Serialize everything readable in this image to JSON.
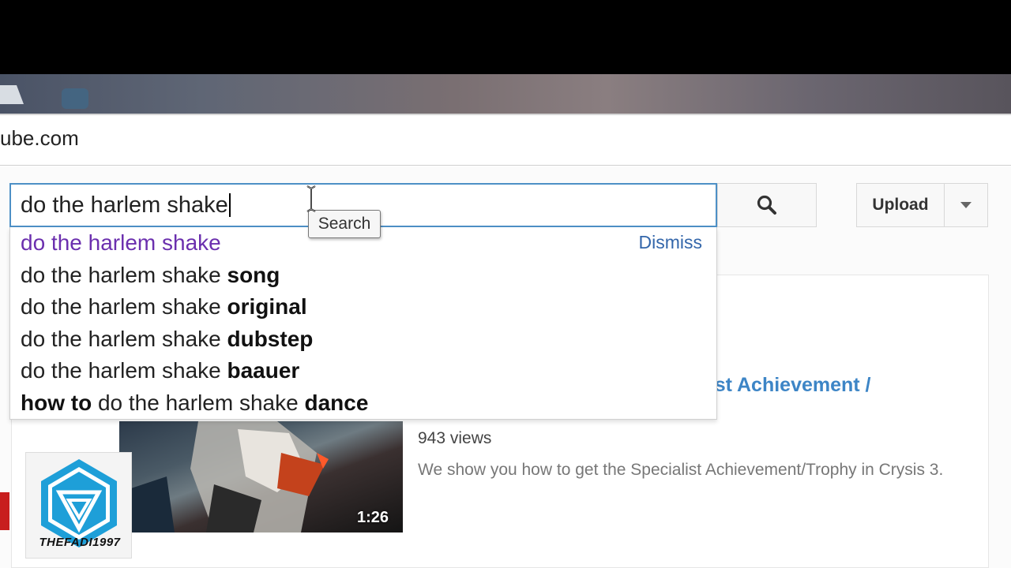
{
  "browser": {
    "url_fragment": "ube.com"
  },
  "search": {
    "query": "do the harlem shake",
    "tooltip": "Search"
  },
  "header": {
    "upload_label": "Upload"
  },
  "suggestions": {
    "dismiss_label": "Dismiss",
    "items": [
      {
        "pre": "",
        "normal": "do the harlem shake",
        "post": "",
        "visited": true
      },
      {
        "pre": "",
        "normal": "do the harlem shake ",
        "post": "song",
        "visited": false
      },
      {
        "pre": "",
        "normal": "do the harlem shake ",
        "post": "original",
        "visited": false
      },
      {
        "pre": "",
        "normal": "do the harlem shake ",
        "post": "dubstep",
        "visited": false
      },
      {
        "pre": "",
        "normal": "do the harlem shake ",
        "post": "baauer",
        "visited": false
      },
      {
        "pre": "how to",
        "normal": " do the harlem shake ",
        "post": "dance",
        "visited": false
      }
    ]
  },
  "video": {
    "title_partial": "ialist Achievement /",
    "duration": "1:26",
    "views": "943 views",
    "description": "We show you how to get the Specialist Achievement/Trophy in Crysis 3."
  },
  "watermark": {
    "channel_name": "THEFADI1997"
  },
  "colors": {
    "accent_blue": "#3d85c6",
    "focus_border": "#4d90c6",
    "visited_purple": "#6b2fae",
    "dismiss_link": "#3366aa"
  },
  "icons": {
    "search": "magnifier-icon",
    "dropdown": "triangle-down-icon",
    "cursor": "i-beam-cursor-icon",
    "logo": "ingress-logo-icon"
  }
}
